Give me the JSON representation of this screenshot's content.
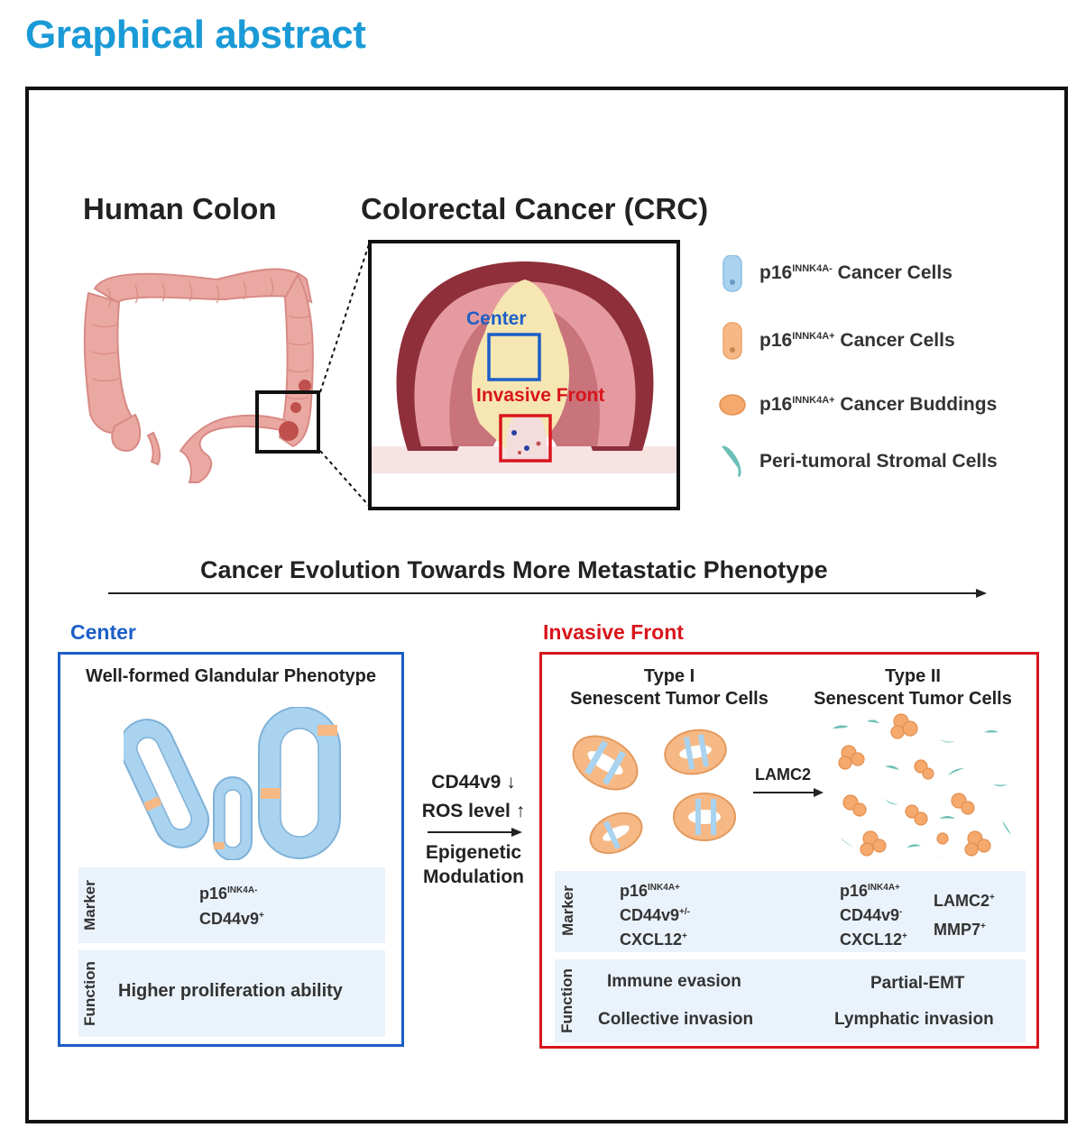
{
  "heading": "Graphical abstract",
  "top": {
    "human_colon": "Human Colon",
    "crc": "Colorectal Cancer (CRC)",
    "inset_center": "Center",
    "inset_front": "Invasive Front"
  },
  "legend": [
    {
      "base": "p16",
      "sup": "INNK4A-",
      "rest": " Cancer Cells",
      "icon": "cancer-cell-negative-icon"
    },
    {
      "base": "p16",
      "sup": "INNK4A+",
      "rest": " Cancer Cells",
      "icon": "cancer-cell-positive-icon"
    },
    {
      "base": "p16",
      "sup": "INNK4A+",
      "rest": " Cancer Buddings",
      "icon": "cancer-budding-icon"
    },
    {
      "base": "",
      "sup": "",
      "rest": "Peri-tumoral Stromal Cells",
      "icon": "stromal-cell-icon"
    }
  ],
  "evolution": "Cancer Evolution Towards More Metastatic Phenotype",
  "center": {
    "label": "Center",
    "subtitle": "Well-formed Glandular Phenotype",
    "marker_label": "Marker",
    "function_label": "Function",
    "markers": [
      {
        "base": "p16",
        "sup": "INK4A-"
      },
      {
        "base": "CD44v9",
        "sup": "+"
      }
    ],
    "function": "Higher proliferation ability"
  },
  "middle": {
    "line1": "CD44v9",
    "line1_arrow": "↓",
    "line2": "ROS level",
    "line2_arrow": "↑",
    "line3": "Epigenetic",
    "line4": "Modulation"
  },
  "front": {
    "label": "Invasive Front",
    "type1_line1": "Type I",
    "type1_line2": "Senescent Tumor Cells",
    "type2_line1": "Type II",
    "type2_line2": "Senescent Tumor Cells",
    "arrow_label": "LAMC2",
    "marker_label": "Marker",
    "function_label": "Function",
    "type1_markers": [
      {
        "base": "p16",
        "sup": "INK4A+"
      },
      {
        "base": "CD44v9",
        "sup": "+/-"
      },
      {
        "base": "CXCL12",
        "sup": "+"
      }
    ],
    "type2_markers_a": [
      {
        "base": "p16",
        "sup": "INK4A+"
      },
      {
        "base": "CD44v9",
        "sup": "-"
      },
      {
        "base": "CXCL12",
        "sup": "+"
      }
    ],
    "type2_markers_b": [
      {
        "base": "LAMC2",
        "sup": "+"
      },
      {
        "base": "MMP7",
        "sup": "+"
      }
    ],
    "type1_functions": [
      "Immune evasion",
      "Collective invasion"
    ],
    "type2_functions": [
      "Partial-EMT",
      "Lymphatic invasion"
    ]
  },
  "colors": {
    "heading": "#1a9ad6",
    "center_blue": "#1c5fc7",
    "front_red": "#d9151c",
    "colon_pink": "#eaa8a2",
    "negative_cell": "#a9d3ef",
    "positive_cell": "#f6b985",
    "stromal": "#6bbfb6",
    "panel_bg": "#eaf2fb"
  }
}
